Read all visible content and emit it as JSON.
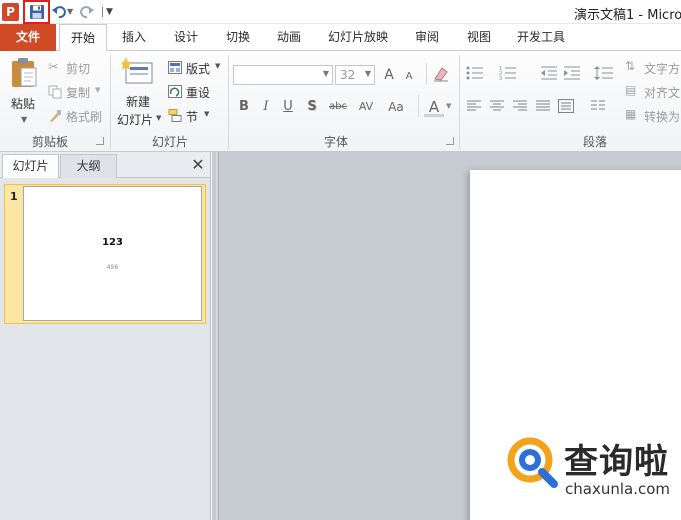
{
  "window": {
    "title": "演示文稿1 - Micro"
  },
  "qat": {
    "app_icon": "P"
  },
  "tabs": [
    {
      "label": "文件"
    },
    {
      "label": "开始"
    },
    {
      "label": "插入"
    },
    {
      "label": "设计"
    },
    {
      "label": "切换"
    },
    {
      "label": "动画"
    },
    {
      "label": "幻灯片放映"
    },
    {
      "label": "审阅"
    },
    {
      "label": "视图"
    },
    {
      "label": "开发工具"
    }
  ],
  "ribbon": {
    "clipboard": {
      "paste": "粘贴",
      "cut": "剪切",
      "copy": "复制",
      "format_painter": "格式刷",
      "label": "剪贴板"
    },
    "slides": {
      "new_slide_line1": "新建",
      "new_slide_line2": "幻灯片",
      "layout": "版式",
      "reset": "重设",
      "section": "节",
      "label": "幻灯片"
    },
    "font": {
      "font_name": "",
      "font_size": "32",
      "bold": "B",
      "italic": "I",
      "underline": "U",
      "shadow": "S",
      "strike": "abc",
      "spacing": "AV",
      "case": "Aa",
      "color": "A",
      "grow": "A",
      "shrink": "A",
      "label": "字体"
    },
    "paragraph": {
      "text_direction": "文字方",
      "align_text": "对齐文",
      "convert": "转换为",
      "label": "段落"
    }
  },
  "leftpane": {
    "tab_slides": "幻灯片",
    "tab_outline": "大纲",
    "close": "✕",
    "slide_number": "1",
    "thumb_title": "123",
    "thumb_subtitle": "456"
  },
  "watermark": {
    "text": "查询啦",
    "url": "chaxunla.com"
  }
}
